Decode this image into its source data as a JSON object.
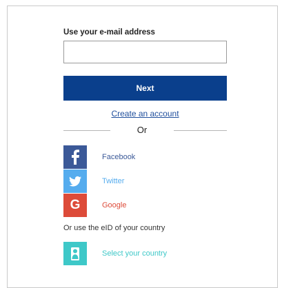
{
  "email": {
    "label": "Use your e-mail address",
    "value": "",
    "placeholder": ""
  },
  "next_label": "Next",
  "create_account_label": "Create an account",
  "or_label": "Or",
  "social": {
    "facebook": {
      "label": "Facebook",
      "icon": "facebook-icon",
      "color": "#3b5998"
    },
    "twitter": {
      "label": "Twitter",
      "icon": "twitter-icon",
      "color": "#55acee"
    },
    "google": {
      "label": "Google",
      "icon": "google-icon",
      "glyph": "G",
      "color": "#dd4b39"
    }
  },
  "eid": {
    "text": "Or use the eID of your country",
    "select_label": "Select your country",
    "icon": "person-icon",
    "color": "#3ec8c8"
  },
  "colors": {
    "primary": "#0a3f8c",
    "link": "#1f4e9c"
  }
}
